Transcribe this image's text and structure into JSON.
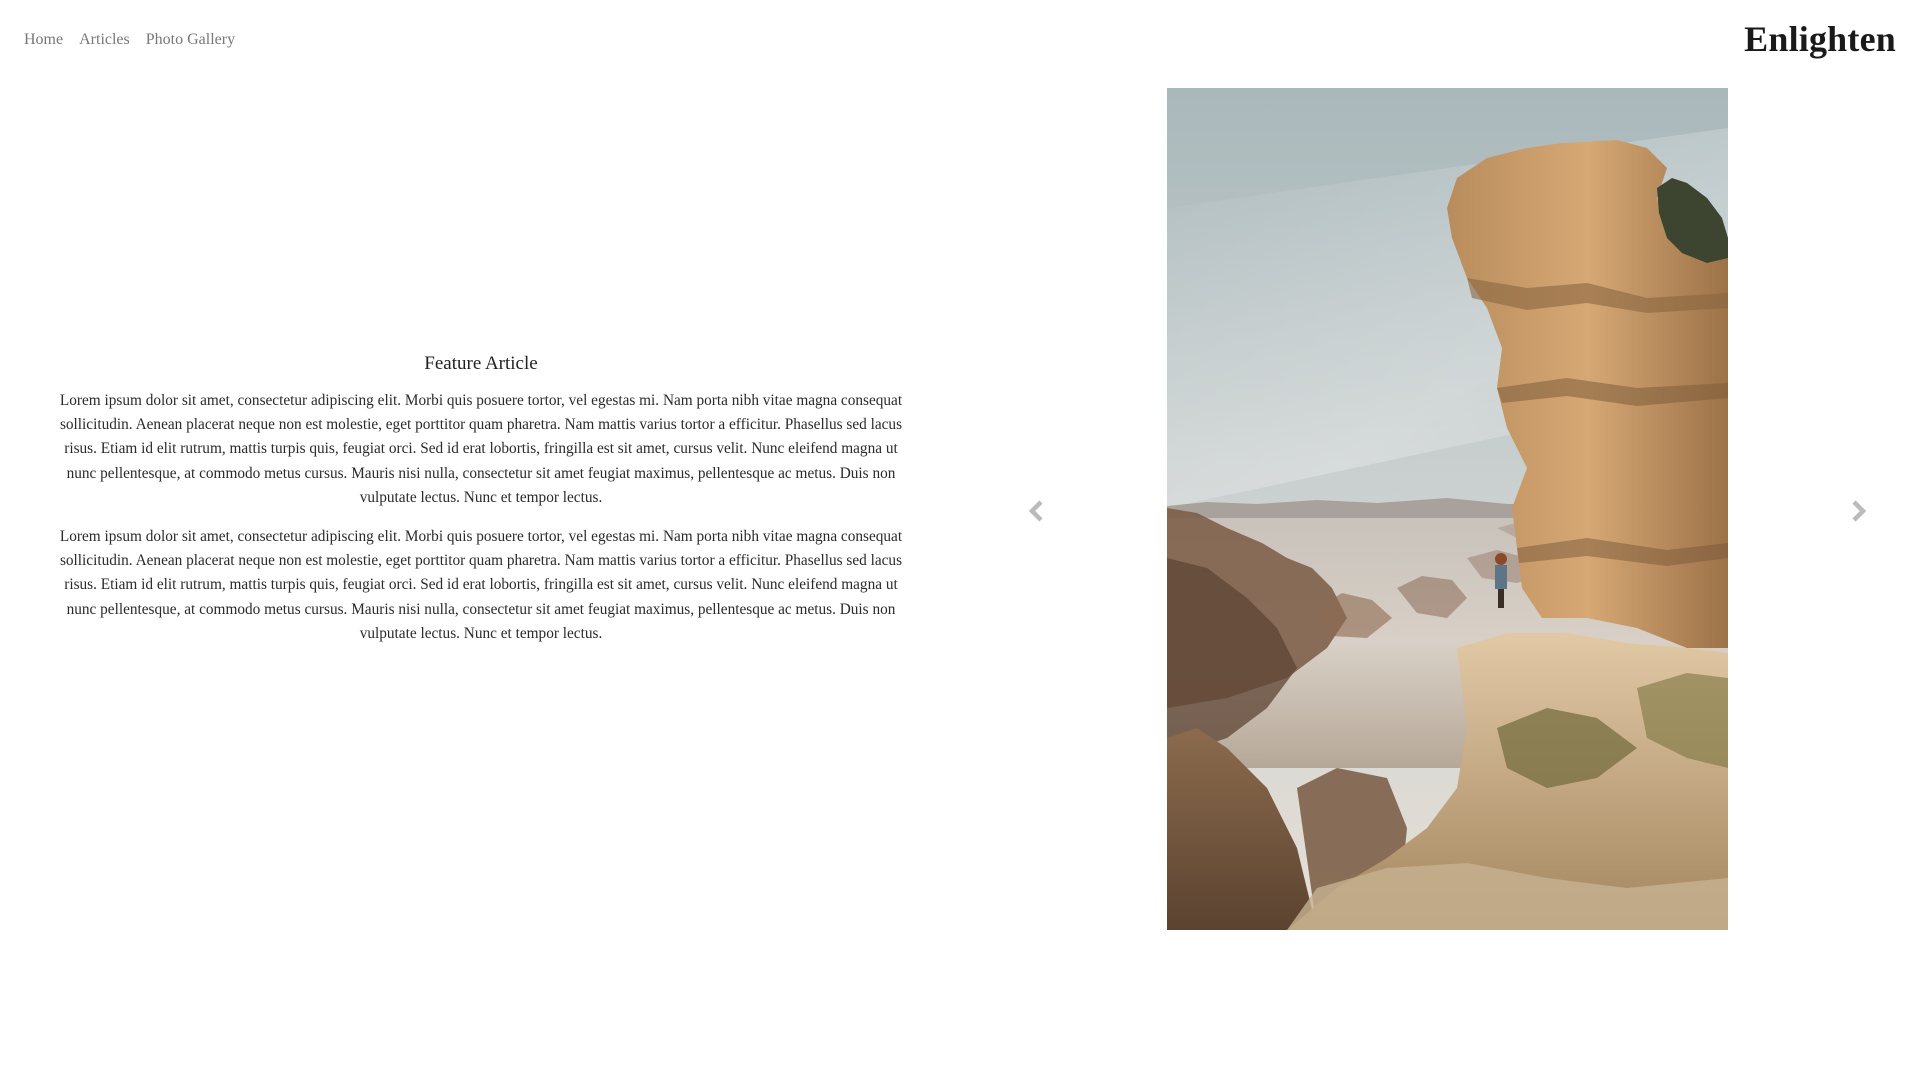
{
  "nav": {
    "items": [
      {
        "label": "Home"
      },
      {
        "label": "Articles"
      },
      {
        "label": "Photo Gallery"
      }
    ]
  },
  "brand": {
    "title": "Enlighten"
  },
  "article": {
    "title": "Feature Article",
    "paragraphs": [
      "Lorem ipsum dolor sit amet, consectetur adipiscing elit. Morbi quis posuere tortor, vel egestas mi. Nam porta nibh vitae magna consequat sollicitudin. Aenean placerat neque non est molestie, eget porttitor quam pharetra. Nam mattis varius tortor a efficitur. Phasellus sed lacus risus. Etiam id elit rutrum, mattis turpis quis, feugiat orci. Sed id erat lobortis, fringilla est sit amet, cursus velit. Nunc eleifend magna ut nunc pellentesque, at commodo metus cursus. Mauris nisi nulla, consectetur sit amet feugiat maximus, pellentesque ac metus. Duis non vulputate lectus. Nunc et tempor lectus.",
      "Lorem ipsum dolor sit amet, consectetur adipiscing elit. Morbi quis posuere tortor, vel egestas mi. Nam porta nibh vitae magna consequat sollicitudin. Aenean placerat neque non est molestie, eget porttitor quam pharetra. Nam mattis varius tortor a efficitur. Phasellus sed lacus risus. Etiam id elit rutrum, mattis turpis quis, feugiat orci. Sed id erat lobortis, fringilla est sit amet, cursus velit. Nunc eleifend magna ut nunc pellentesque, at commodo metus cursus. Mauris nisi nulla, consectetur sit amet feugiat maximus, pellentesque ac metus. Duis non vulputate lectus. Nunc et tempor lectus."
    ]
  },
  "gallery": {
    "prev_icon": "chevron-left-icon",
    "next_icon": "chevron-right-icon",
    "image": "photo-hiker-on-cliff-above-misty-canyon"
  },
  "colors": {
    "background": "#ffffff",
    "nav_text": "#777777",
    "brand_text": "#1a1a1a",
    "body_text": "#2a2a2a",
    "arrow": "#bbbbbb"
  }
}
